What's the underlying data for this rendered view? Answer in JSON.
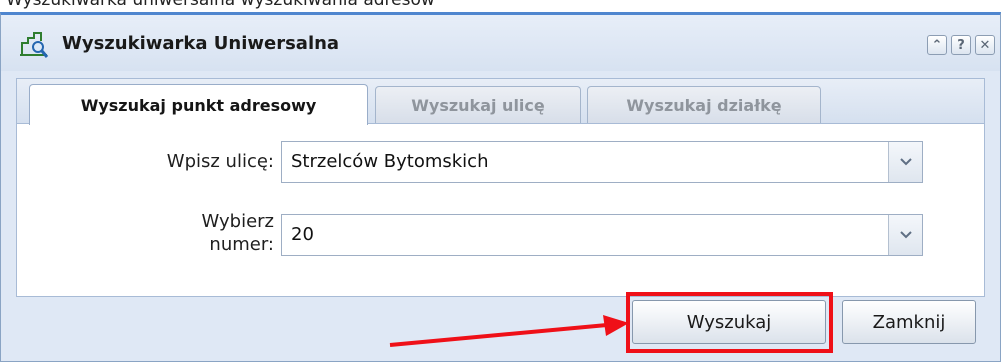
{
  "top_fragment": "Wyszukiwarka uniwersalna wyszukiwania adresow",
  "window": {
    "title": "Wyszukiwarka Uniwersalna",
    "title_icon": "map-search-icon",
    "controls": [
      {
        "name": "collapse-up-icon",
        "label": "⌃"
      },
      {
        "name": "help-icon",
        "label": "?"
      },
      {
        "name": "close-icon",
        "label": "✕"
      }
    ]
  },
  "tabs": [
    {
      "label": "Wyszukaj punkt adresowy",
      "active": true
    },
    {
      "label": "Wyszukaj ulicę",
      "active": false
    },
    {
      "label": "Wyszukaj działkę",
      "active": false
    }
  ],
  "form": {
    "street_label": "Wpisz ulicę:",
    "street_value": "Strzelców Bytomskich",
    "number_label_line1": "Wybierz",
    "number_label_line2": "numer:",
    "number_value": "20"
  },
  "buttons": {
    "search": "Wyszukaj",
    "close": "Zamknij"
  },
  "colors": {
    "title_border": "#4f86cf",
    "highlight": "#ef1018"
  }
}
